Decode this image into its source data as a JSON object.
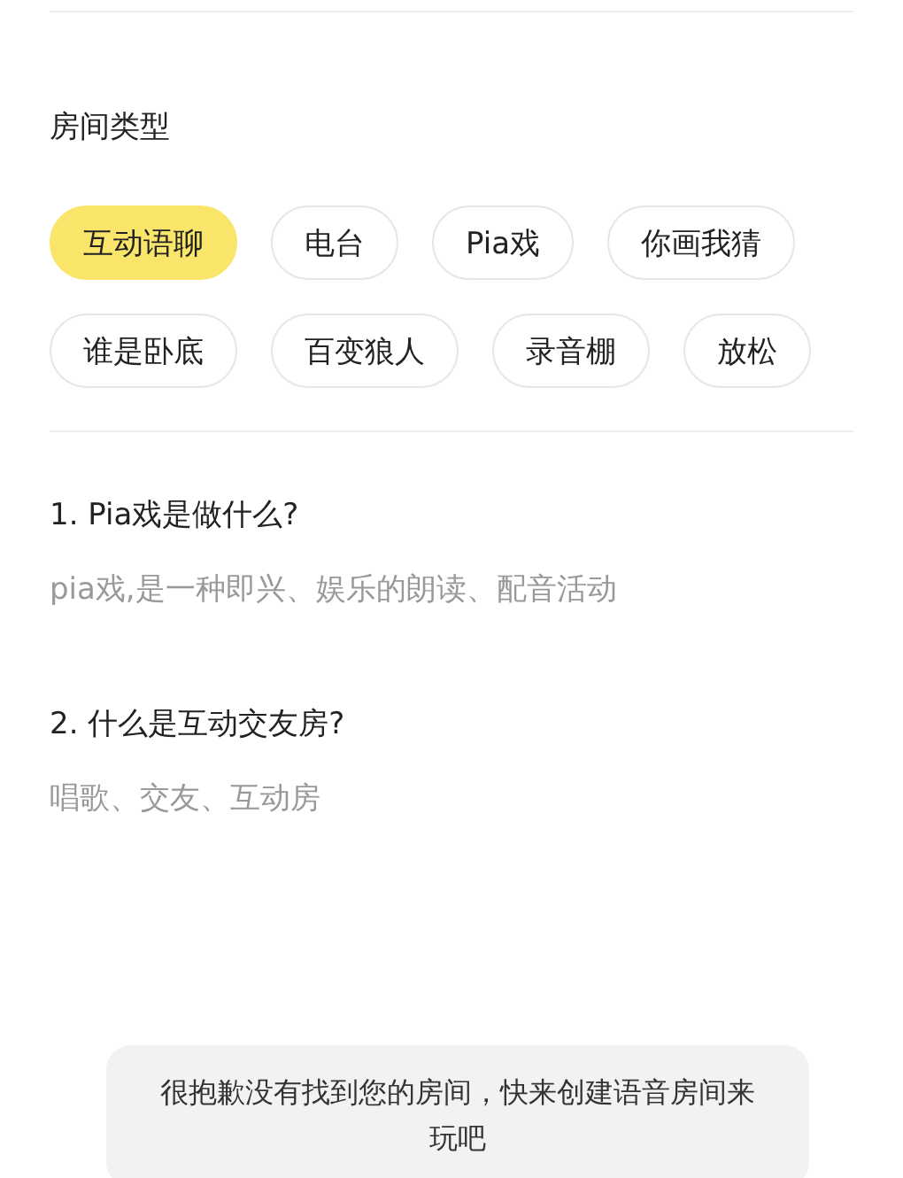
{
  "section_title": "房间类型",
  "room_types": [
    {
      "label": "互动语聊",
      "selected": true
    },
    {
      "label": "电台",
      "selected": false
    },
    {
      "label": "Pia戏",
      "selected": false
    },
    {
      "label": "你画我猜",
      "selected": false
    },
    {
      "label": "谁是卧底",
      "selected": false
    },
    {
      "label": "百变狼人",
      "selected": false
    },
    {
      "label": "录音棚",
      "selected": false
    },
    {
      "label": "放松",
      "selected": false
    }
  ],
  "faq": [
    {
      "question": "1. Pia戏是做什么?",
      "answer": "pia戏,是一种即兴、娱乐的朗读、配音活动"
    },
    {
      "question": "2. 什么是互动交友房?",
      "answer": "唱歌、交友、互动房"
    }
  ],
  "toast": "很抱歉没有找到您的房间，快来创建语音房间来玩吧"
}
